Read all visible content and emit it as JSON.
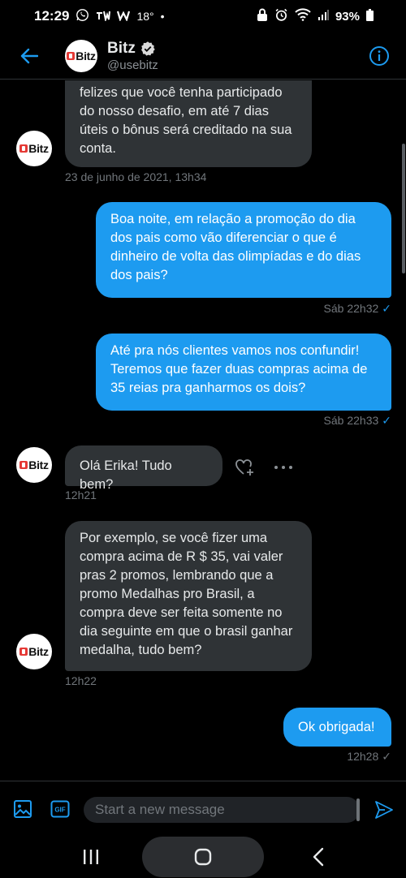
{
  "status_bar": {
    "time": "12:29",
    "extra": "18°",
    "battery": "93%"
  },
  "header": {
    "name": "Bitz",
    "handle": "@usebitz",
    "logo_text": "Bitz"
  },
  "messages": {
    "m1": {
      "lines": [
        "felizes que você tenha participado",
        "do nosso desafio, em até 7 dias",
        "úteis o bônus será creditado na sua",
        "conta."
      ],
      "time": "23 de junho de 2021, 13h34"
    },
    "m2": {
      "lines": [
        "Boa noite, em relação a promoção do dia",
        "dos pais como vão diferenciar o que é",
        "dinheiro de volta das olimpíadas e do dias",
        "dos pais?"
      ],
      "time": "Sáb 22h32"
    },
    "m3": {
      "lines": [
        "Até pra nós clientes vamos nos confundir!",
        "Teremos que fazer duas compras acima de",
        "35 reias pra ganharmos os dois?"
      ],
      "time": "Sáb 22h33"
    },
    "m4": {
      "lines": [
        "Olá Erika! Tudo bem?"
      ],
      "time": "12h21"
    },
    "m5": {
      "lines": [
        "Por exemplo, se você fizer uma",
        "compra acima de R $ 35, vai valer",
        "pras 2 promos, lembrando que a",
        "promo Medalhas pro Brasil, a",
        "compra deve ser feita somente no",
        "dia seguinte em que o brasil ganhar",
        "medalha, tudo bem?"
      ],
      "time": "12h22"
    },
    "m6": {
      "lines": [
        "Ok obrigada!"
      ],
      "time": "12h28"
    }
  },
  "composer": {
    "placeholder": "Start a new message"
  },
  "colors": {
    "accent": "#1d9bf0",
    "bubble_in": "#2f3336",
    "background": "#000000",
    "brand_red": "#e53935"
  }
}
